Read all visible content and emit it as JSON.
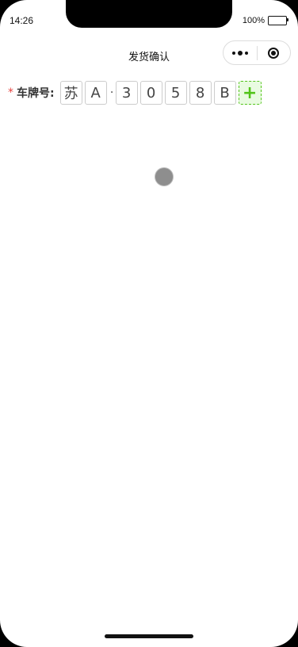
{
  "status_bar": {
    "time": "14:26",
    "battery_text": "100%",
    "battery_level": 1.0
  },
  "nav": {
    "title": "发货确认"
  },
  "form": {
    "required_mark": "*",
    "plate_label": "车牌号:",
    "plate_chars": [
      "苏",
      "A",
      "3",
      "0",
      "5",
      "8",
      "B"
    ],
    "plate_separator": "·",
    "add_label": "+"
  },
  "colors": {
    "required": "#e64340",
    "add_accent": "#52c41a",
    "add_bg": "#e9fbe1"
  },
  "icons": {
    "more": "more-dots-icon",
    "close": "close-circle-icon",
    "battery": "battery-icon",
    "loading": "loading-spinner-icon"
  }
}
